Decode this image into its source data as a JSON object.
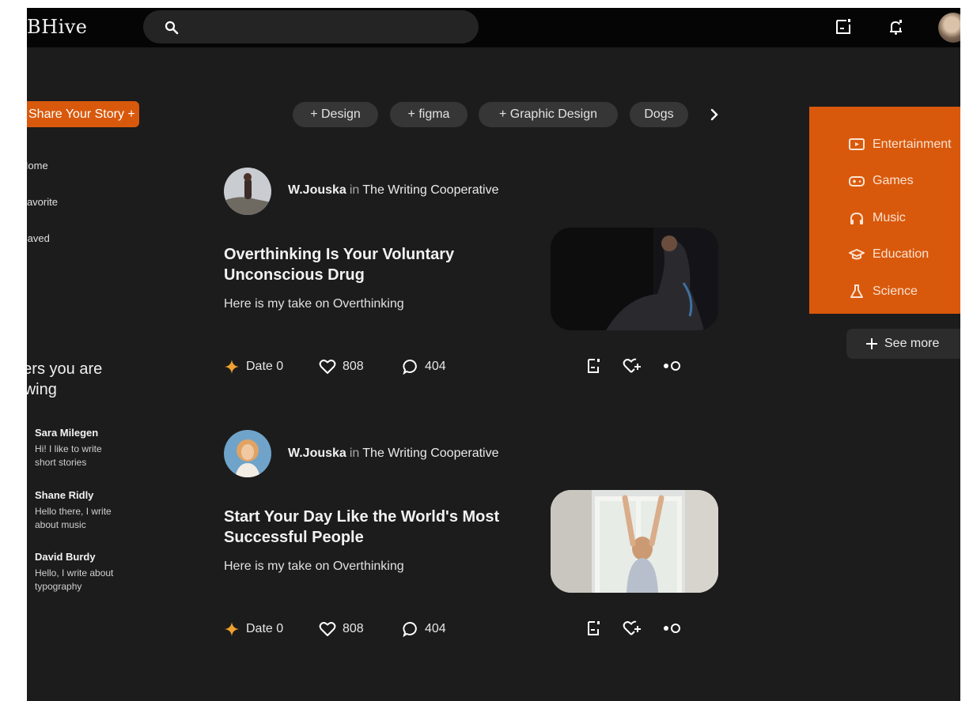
{
  "app": {
    "logo": "BHive"
  },
  "search": {
    "placeholder": ""
  },
  "sidebar": {
    "share_label": "Share Your Story +",
    "links": [
      {
        "label": "Home"
      },
      {
        "label": "Favorite"
      },
      {
        "label": "Saved"
      }
    ],
    "following_title": "Writers you are following",
    "following": [
      {
        "name": "Sara Milegen",
        "bio": "Hi! I like to write short stories"
      },
      {
        "name": "Shane Ridly",
        "bio": "Hello there, I write about music"
      },
      {
        "name": "David Burdy",
        "bio": "Hello, I write about typography"
      }
    ]
  },
  "tags": [
    "+ Design",
    "+ figma",
    "+ Graphic Design",
    "Dogs"
  ],
  "posts": [
    {
      "author": "W.Jouska",
      "in": "in",
      "publication": "The Writing Cooperative",
      "title": "Overthinking Is Your Voluntary Unconscious Drug",
      "subtitle": "Here is my take on Overthinking",
      "date": "Date 0",
      "likes": "808",
      "comments": "404"
    },
    {
      "author": "W.Jouska",
      "in": "in",
      "publication": "The Writing Cooperative",
      "title": "Start Your Day Like the World's Most Successful People",
      "subtitle": "Here is my take on Overthinking",
      "date": "Date 0",
      "likes": "808",
      "comments": "404"
    }
  ],
  "categories": [
    {
      "label": "Entertainment",
      "icon": "tv-icon"
    },
    {
      "label": "Games",
      "icon": "gamepad-icon"
    },
    {
      "label": "Music",
      "icon": "headphones-icon"
    },
    {
      "label": "Education",
      "icon": "graduation-cap-icon"
    },
    {
      "label": "Science",
      "icon": "flask-icon"
    }
  ],
  "see_more_label": "See more",
  "colors": {
    "accent": "#d9590c",
    "background": "#1c1c1c",
    "topbar": "#050505",
    "star": "#f0a030"
  }
}
